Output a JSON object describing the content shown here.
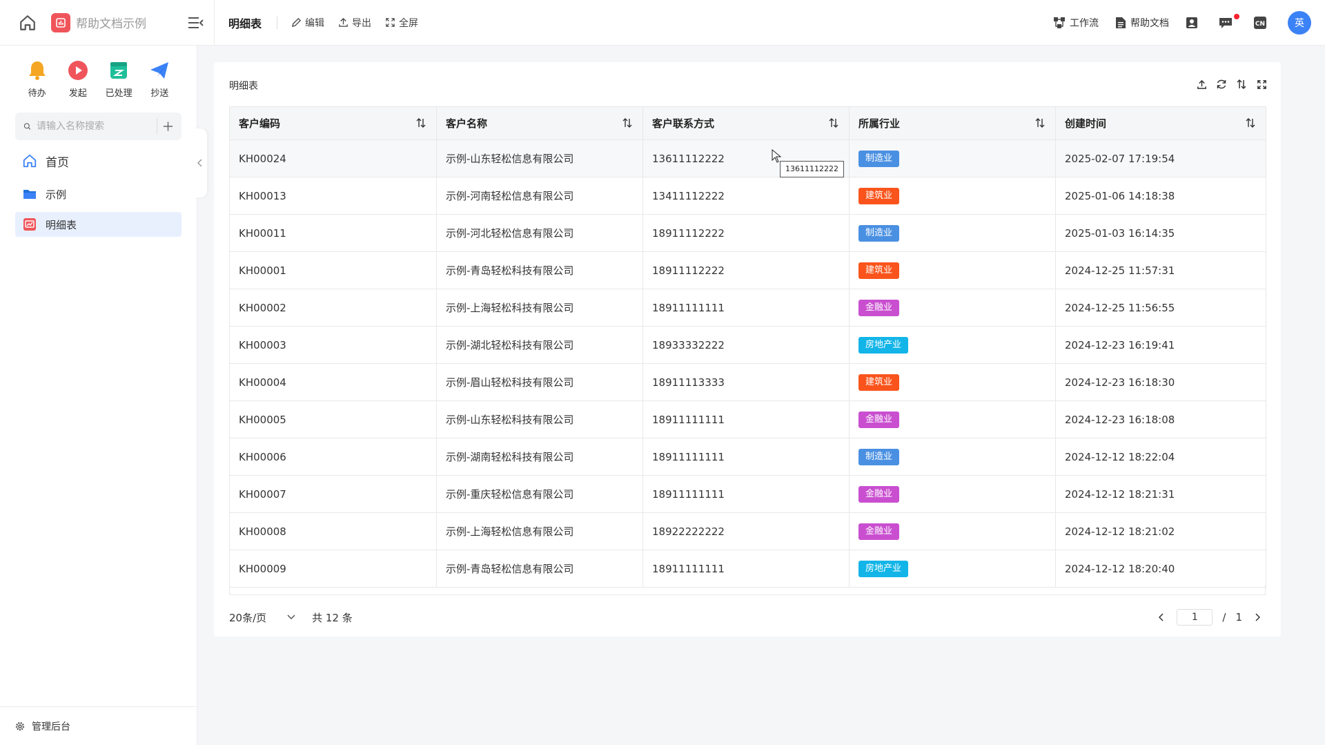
{
  "header": {
    "brand_title": "帮助文档示例",
    "page_title": "明细表",
    "tools": [
      "编辑",
      "导出",
      "全屏"
    ],
    "workflow_label": "工作流",
    "help_label": "帮助文档",
    "lang_icon_text": "CN",
    "avatar_text": "英"
  },
  "sidebar": {
    "quick": [
      {
        "label": "待办",
        "icon": "bell-icon",
        "color": "#f5a623"
      },
      {
        "label": "发起",
        "icon": "play-icon",
        "color": "#f0545b"
      },
      {
        "label": "已处理",
        "icon": "done-icon",
        "color": "#1fbf9a"
      },
      {
        "label": "抄送",
        "icon": "send-icon",
        "color": "#3b82f6"
      }
    ],
    "search_placeholder": "请输入名称搜索",
    "nav": [
      {
        "label": "首页",
        "icon": "home-icon"
      },
      {
        "label": "示例",
        "icon": "folder-icon"
      },
      {
        "label": "明细表",
        "icon": "report-icon",
        "active": true
      }
    ],
    "footer_label": "管理后台"
  },
  "main": {
    "card_title": "明细表",
    "columns": [
      "客户编码",
      "客户名称",
      "客户联系方式",
      "所属行业",
      "创建时间"
    ],
    "rows": [
      {
        "code": "KH00024",
        "name": "示例-山东轻松信息有限公司",
        "phone": "13611112222",
        "industry": "制造业",
        "created": "2025-02-07 17:19:54"
      },
      {
        "code": "KH00013",
        "name": "示例-河南轻松信息有限公司",
        "phone": "13411112222",
        "industry": "建筑业",
        "created": "2025-01-06 14:18:38"
      },
      {
        "code": "KH00011",
        "name": "示例-河北轻松信息有限公司",
        "phone": "18911112222",
        "industry": "制造业",
        "created": "2025-01-03 16:14:35"
      },
      {
        "code": "KH00001",
        "name": "示例-青岛轻松科技有限公司",
        "phone": "18911112222",
        "industry": "建筑业",
        "created": "2024-12-25 11:57:31"
      },
      {
        "code": "KH00002",
        "name": "示例-上海轻松科技有限公司",
        "phone": "18911111111",
        "industry": "金融业",
        "created": "2024-12-25 11:56:55"
      },
      {
        "code": "KH00003",
        "name": "示例-湖北轻松科技有限公司",
        "phone": "18933332222",
        "industry": "房地产业",
        "created": "2024-12-23 16:19:41"
      },
      {
        "code": "KH00004",
        "name": "示例-眉山轻松科技有限公司",
        "phone": "18911113333",
        "industry": "建筑业",
        "created": "2024-12-23 16:18:30"
      },
      {
        "code": "KH00005",
        "name": "示例-山东轻松科技有限公司",
        "phone": "18911111111",
        "industry": "金融业",
        "created": "2024-12-23 16:18:08"
      },
      {
        "code": "KH00006",
        "name": "示例-湖南轻松科技有限公司",
        "phone": "18911111111",
        "industry": "制造业",
        "created": "2024-12-12 18:22:04"
      },
      {
        "code": "KH00007",
        "name": "示例-重庆轻松信息有限公司",
        "phone": "18911111111",
        "industry": "金融业",
        "created": "2024-12-12 18:21:31"
      },
      {
        "code": "KH00008",
        "name": "示例-上海轻松信息有限公司",
        "phone": "18922222222",
        "industry": "金融业",
        "created": "2024-12-12 18:21:02"
      },
      {
        "code": "KH00009",
        "name": "示例-青岛轻松信息有限公司",
        "phone": "18911111111",
        "industry": "房地产业",
        "created": "2024-12-12 18:20:40"
      }
    ],
    "industry_colors": {
      "制造业": "#4a90e2",
      "建筑业": "#fa541c",
      "金融业": "#c94fd0",
      "房地产业": "#13b5e8"
    },
    "tooltip": "13611112222",
    "pager": {
      "page_size": "20条/页",
      "total": "共 12 条",
      "current": "1",
      "sep": "/",
      "pages": "1"
    }
  }
}
